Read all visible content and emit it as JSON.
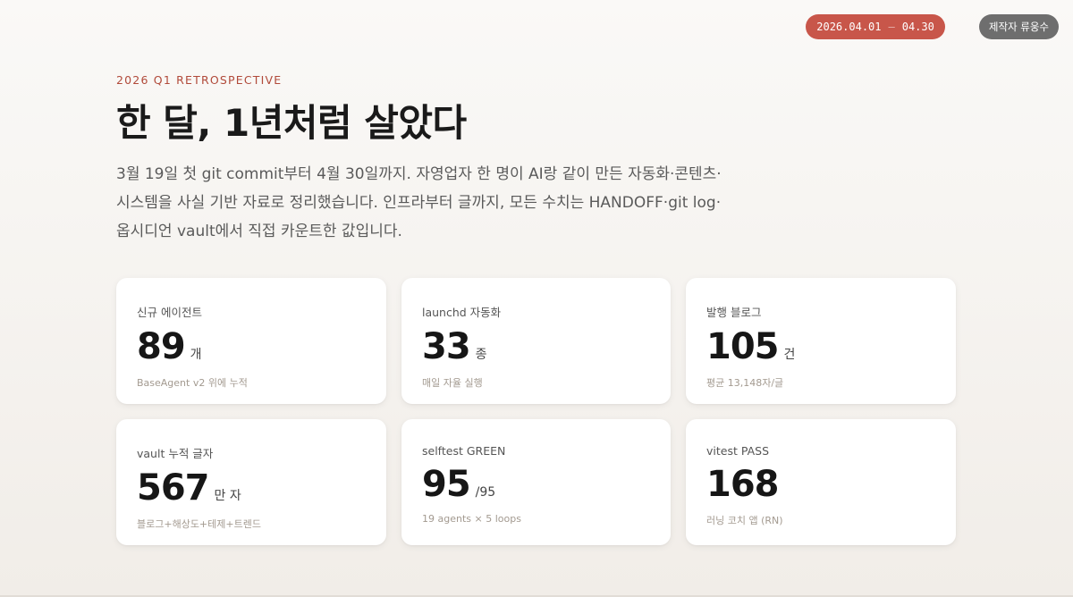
{
  "header": {
    "date_start": "2026.04.01",
    "date_sep": "—",
    "date_end": "04.30",
    "maker_label": "제작자 류웅수"
  },
  "hero": {
    "eyebrow": "2026 Q1 RETROSPECTIVE",
    "title": "한 달, 1년처럼 살았다",
    "lede": "3월 19일 첫 git commit부터 4월 30일까지. 자영업자 한 명이 AI랑 같이 만든 자동화·콘텐츠·시스템을 사실 기반 자료로 정리했습니다. 인프라부터 글까지, 모든 수치는 HANDOFF·git log·옵시디언 vault에서 직접 카운트한 값입니다."
  },
  "cards": [
    {
      "label": "신규 에이전트",
      "value": "89",
      "unit": "개",
      "sub": "BaseAgent v2 위에 누적"
    },
    {
      "label": "launchd 자동화",
      "value": "33",
      "unit": "종",
      "sub": "매일 자율 실행"
    },
    {
      "label": "발행 블로그",
      "value": "105",
      "unit": "건",
      "sub": "평균 13,148자/글"
    },
    {
      "label": "vault 누적 글자",
      "value": "567",
      "unit": "만 자",
      "sub": "블로그+해상도+테제+트렌드"
    },
    {
      "label": "selftest GREEN",
      "value": "95",
      "unit": "/95",
      "sub": "19 agents × 5 loops"
    },
    {
      "label": "vitest PASS",
      "value": "168",
      "unit": "",
      "sub": "러닝 코치 앱 (RN)"
    }
  ],
  "colors": {
    "accent": "#c8564a",
    "eyebrow": "#b14a3a",
    "maker_pill": "#6e6e6e"
  }
}
